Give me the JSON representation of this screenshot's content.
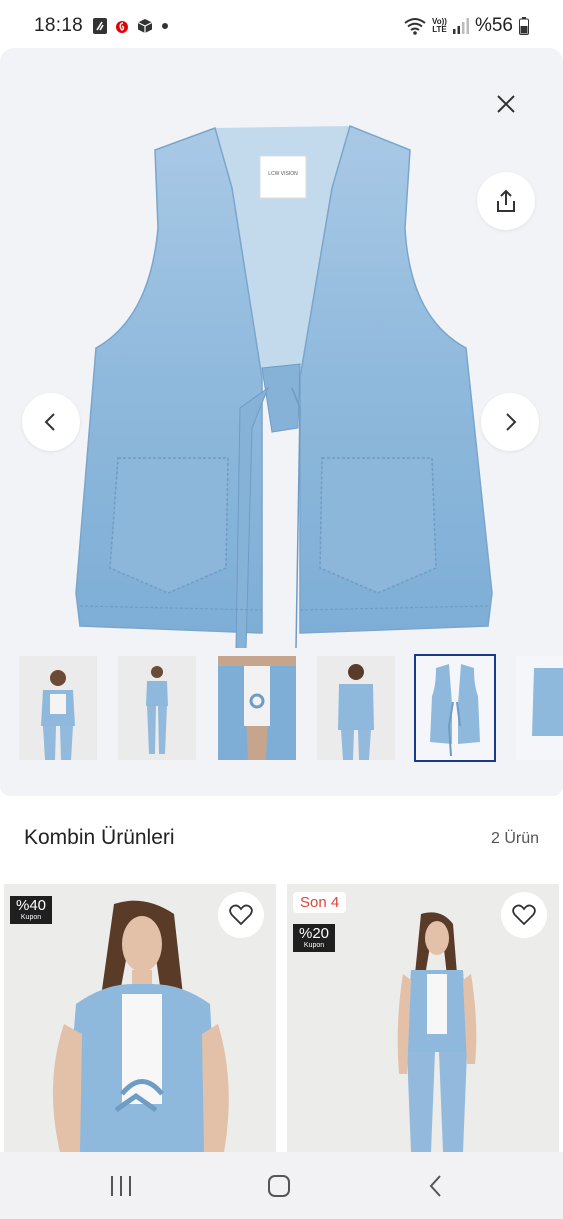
{
  "status_bar": {
    "time": "18:18",
    "volte_top": "Vo))",
    "volte_bottom": "LTE",
    "battery": "%56",
    "left_icons": [
      "nfc-icon",
      "vodafone-icon",
      "box-icon",
      "dot-icon"
    ],
    "right_icons": [
      "wifi-icon",
      "volte-icon",
      "signal-icon",
      "battery-icon"
    ]
  },
  "gallery": {
    "product_label_text": "LCW VISION",
    "thumbnail_count": 6,
    "selected_thumbnail": 5
  },
  "combo_section": {
    "title": "Kombin Ürünleri",
    "count": "2 Ürün"
  },
  "products": [
    {
      "coupon_percent": "%40",
      "coupon_label": "Kupon",
      "stock_badge": ""
    },
    {
      "coupon_percent": "%20",
      "coupon_label": "Kupon",
      "stock_badge": "Son 4"
    }
  ],
  "colors": {
    "denim": "#8fb9dc",
    "selected_border": "#1a3b8a",
    "badge_red": "#e0443c"
  }
}
